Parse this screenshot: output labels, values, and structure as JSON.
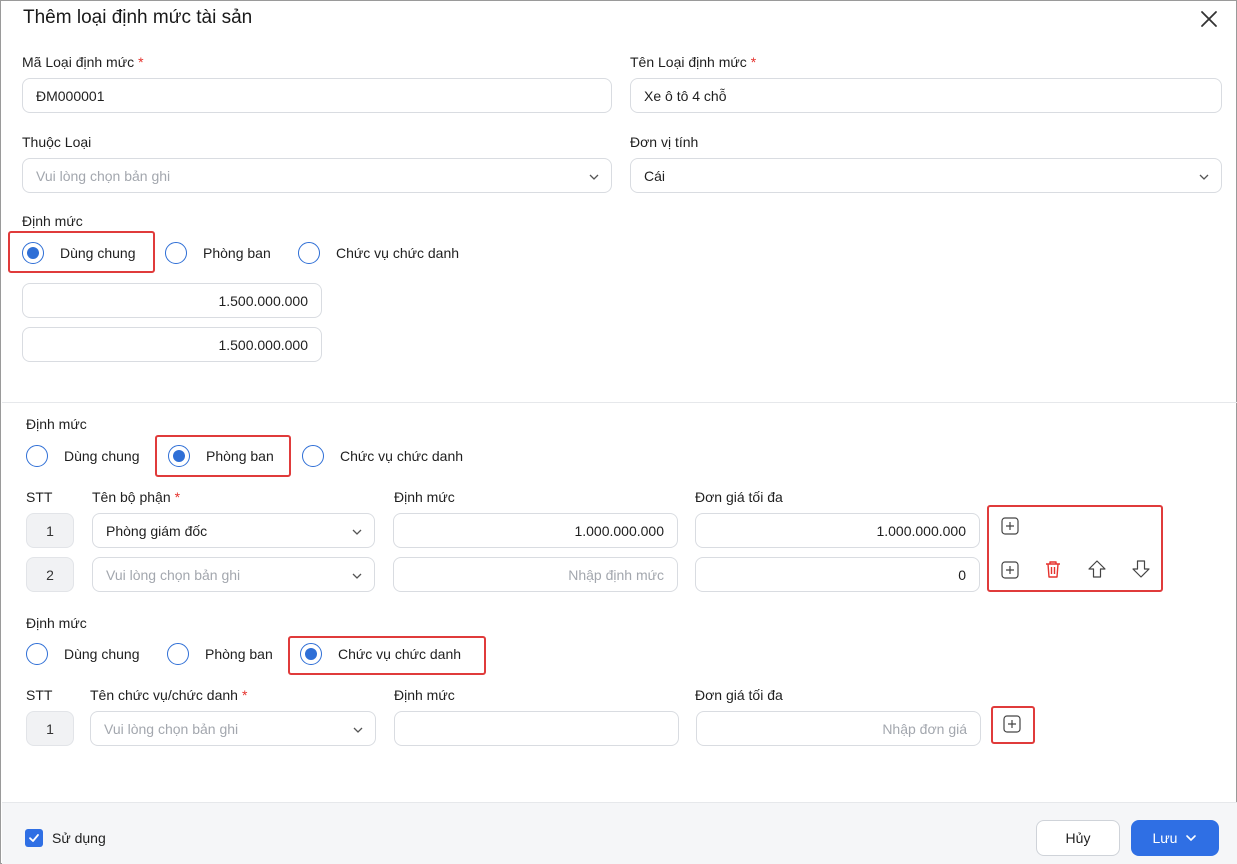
{
  "dialog": {
    "title": "Thêm loại định mức tài sản"
  },
  "form": {
    "code_label": "Mã Loại định mức",
    "code_value": "ĐM000001",
    "name_label": "Tên Loại định mức",
    "name_value": "Xe ô tô 4 chỗ",
    "type_label": "Thuộc Loại",
    "type_placeholder": "Vui lòng chọn bản ghi",
    "unit_label": "Đơn vị tính",
    "unit_value": "Cái",
    "required_mark": "*"
  },
  "radio_labels": {
    "common": "Dùng chung",
    "department": "Phòng ban",
    "position": "Chức vụ chức danh"
  },
  "section1": {
    "label": "Định mức",
    "selected": "common",
    "value1": "1.500.000.000",
    "value2": "1.500.000.000"
  },
  "section2": {
    "label": "Định mức",
    "selected": "department",
    "headers": {
      "stt": "STT",
      "name": "Tên bộ phận",
      "quota": "Định mức",
      "max_price": "Đơn giá tối đa"
    },
    "rows": [
      {
        "stt": "1",
        "name": "Phòng giám đốc",
        "quota": "1.000.000.000",
        "max_price": "1.000.000.000"
      },
      {
        "stt": "2",
        "name_placeholder": "Vui lòng chọn bản ghi",
        "quota_placeholder": "Nhập định mức",
        "max_price": "0"
      }
    ]
  },
  "section3": {
    "label": "Định mức",
    "selected": "position",
    "headers": {
      "stt": "STT",
      "name": "Tên chức vụ/chức danh",
      "quota": "Định mức",
      "max_price": "Đơn giá tối đa"
    },
    "rows": [
      {
        "stt": "1",
        "name_placeholder": "Vui lòng chọn bản ghi",
        "quota": "",
        "max_price_placeholder": "Nhập đơn giá"
      }
    ]
  },
  "footer": {
    "use_label": "Sử dụng",
    "use_checked": true,
    "cancel_label": "Hủy",
    "save_label": "Lưu"
  },
  "icons": {
    "close": "close-icon",
    "chevron": "chevron-down-icon",
    "add": "plus-square-icon",
    "delete": "trash-icon",
    "up": "arrow-up-icon",
    "down": "arrow-down-icon",
    "check": "check-icon"
  },
  "colors": {
    "accent": "#2f6fe4",
    "highlight": "#e03b3b",
    "delete": "#e5322d"
  }
}
